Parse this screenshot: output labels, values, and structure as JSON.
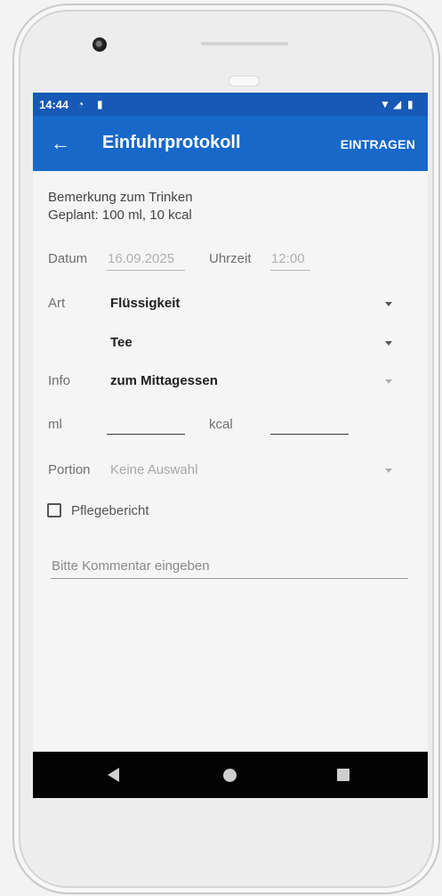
{
  "status": {
    "time": "14:44"
  },
  "appbar": {
    "title": "Einfuhrprotokoll",
    "action": "EINTRAGEN"
  },
  "note": {
    "line1": "Bemerkung zum Trinken",
    "line2": "Geplant: 100 ml, 10 kcal"
  },
  "datum": {
    "label": "Datum",
    "value": "16.09.2025"
  },
  "uhrzeit": {
    "label": "Uhrzeit",
    "value": "12:00"
  },
  "art": {
    "label": "Art",
    "value": "Flüssigkeit",
    "sub_value": "Tee"
  },
  "info": {
    "label": "Info",
    "value": "zum Mittagessen"
  },
  "ml": {
    "label": "ml",
    "value": ""
  },
  "kcal": {
    "label": "kcal",
    "value": ""
  },
  "portion": {
    "label": "Portion",
    "value": "Keine Auswahl"
  },
  "pflegebericht": {
    "label": "Pflegebericht",
    "checked": false
  },
  "comment": {
    "placeholder": "Bitte Kommentar eingeben"
  },
  "icons": [
    "back-arrow-icon",
    "wifi-icon",
    "signal-icon",
    "battery-icon",
    "nav-back-icon",
    "nav-home-icon",
    "nav-recents-icon"
  ]
}
